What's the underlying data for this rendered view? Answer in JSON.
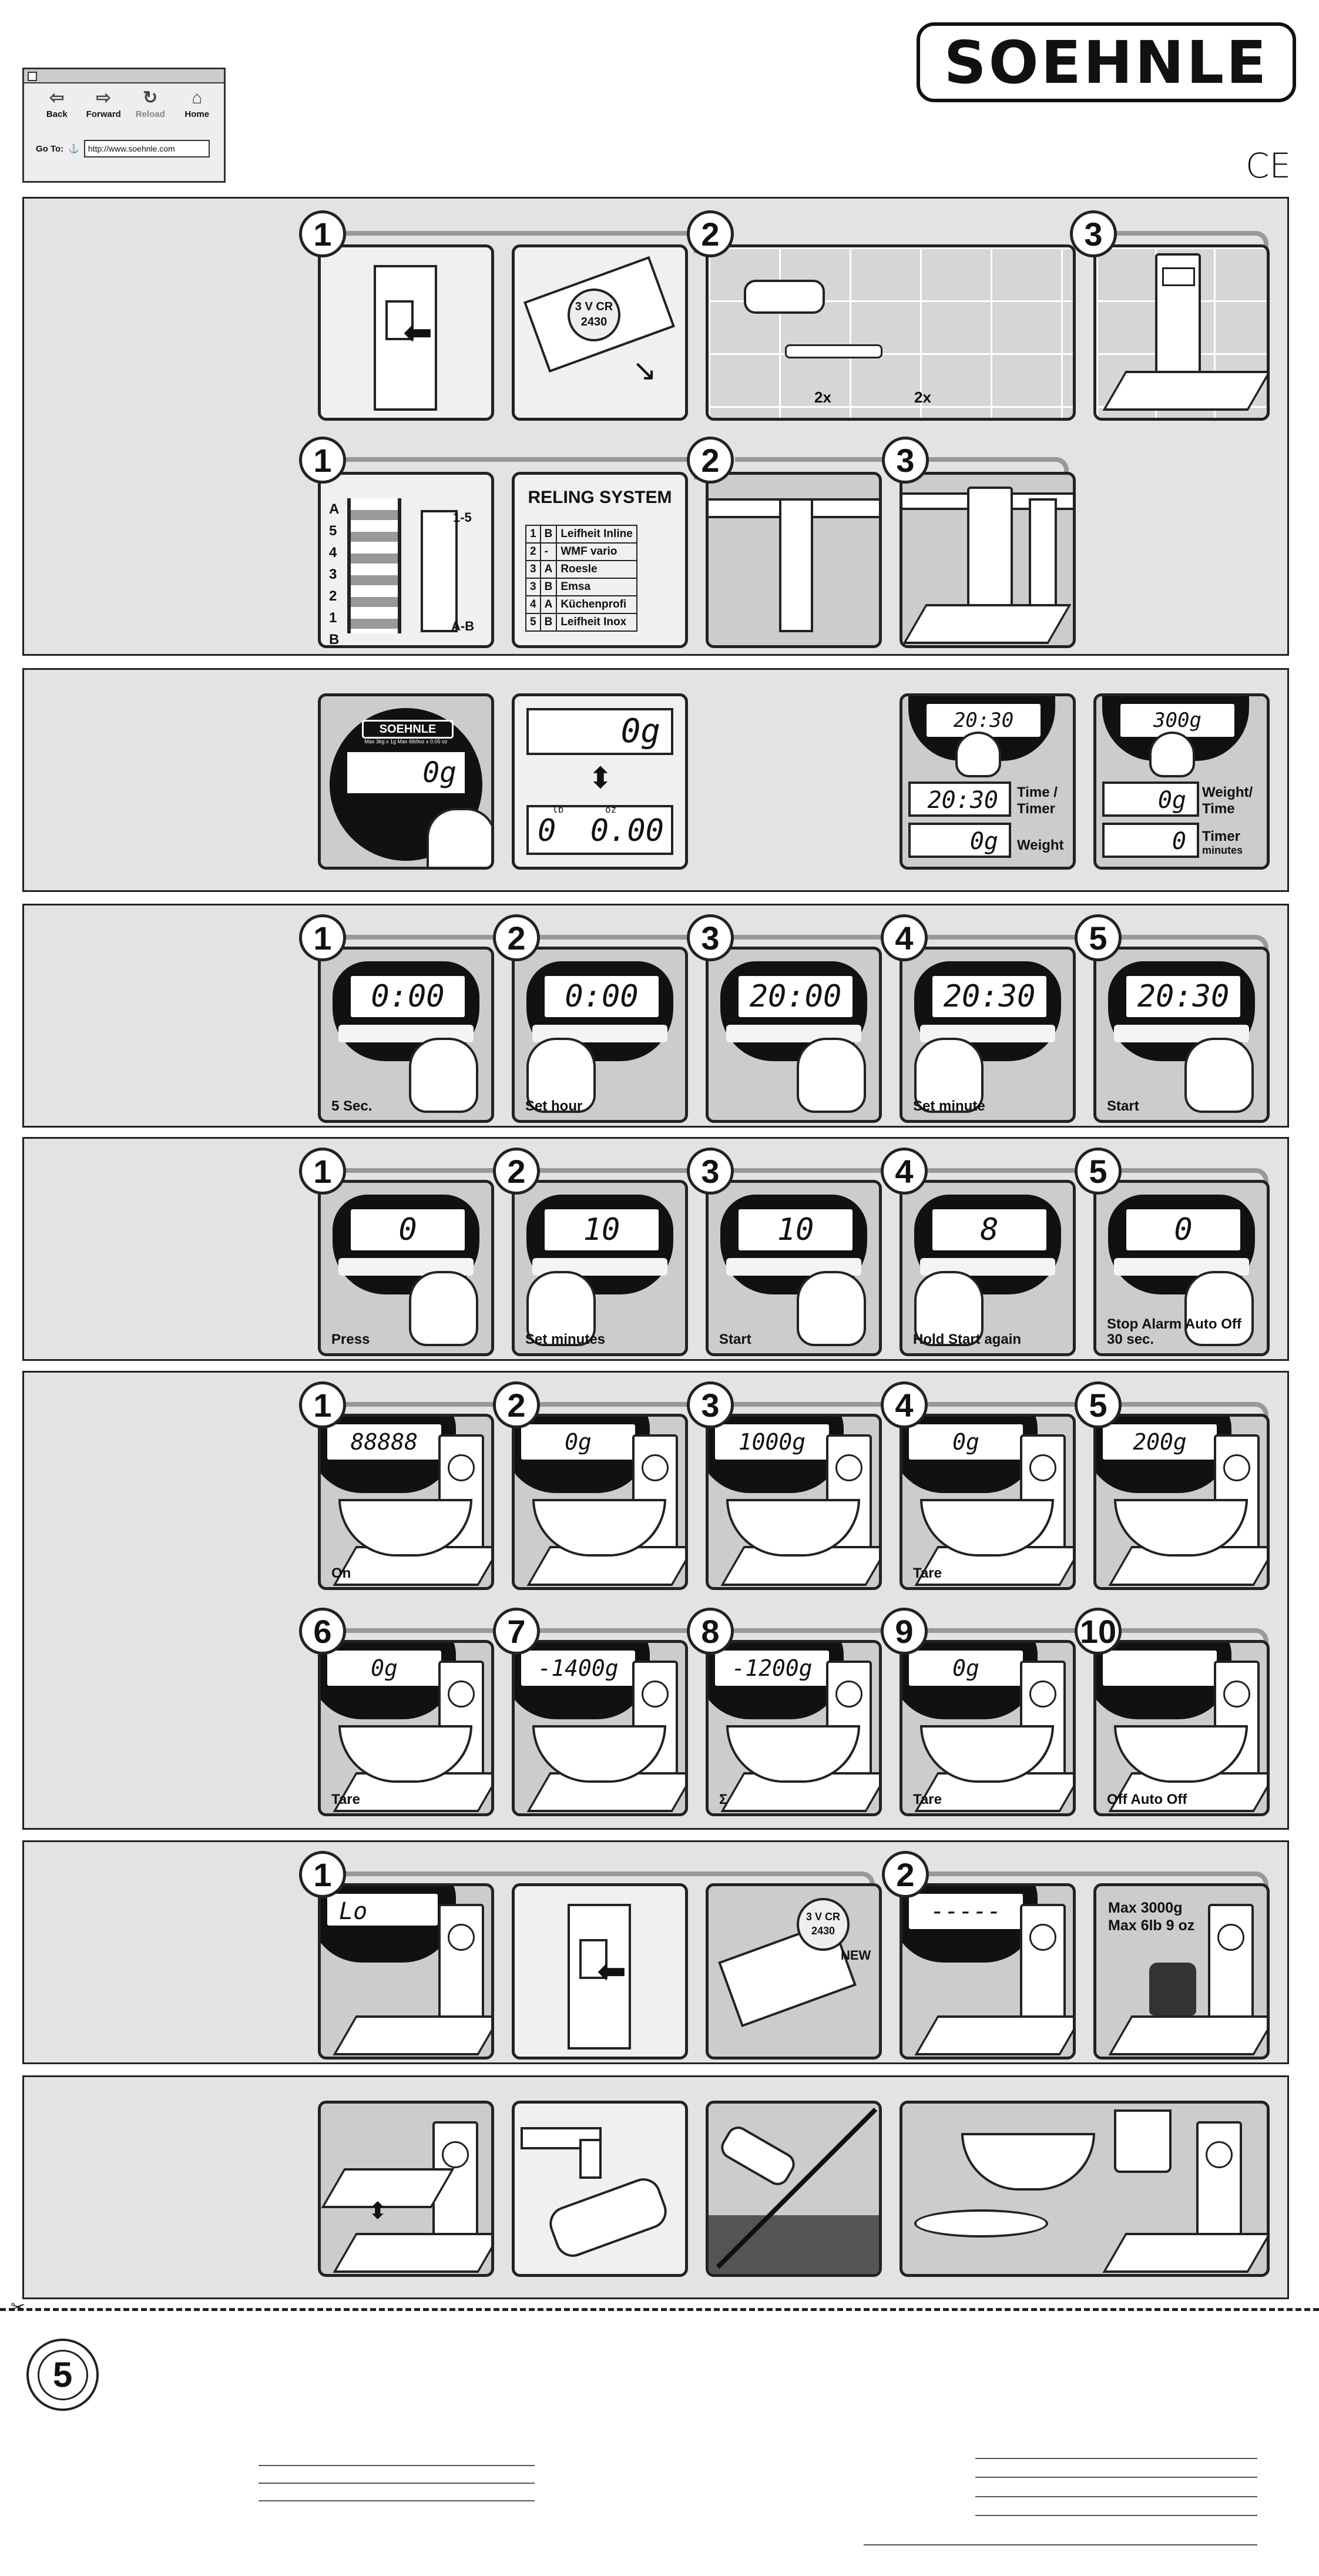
{
  "browser": {
    "buttons": [
      {
        "label": "Back",
        "icon": "back-arrow-icon"
      },
      {
        "label": "Forward",
        "icon": "forward-arrow-icon"
      },
      {
        "label": "Reload",
        "icon": "reload-icon"
      },
      {
        "label": "Home",
        "icon": "home-icon"
      }
    ],
    "goto_label": "Go To:",
    "url": "http://www.soehnle.com"
  },
  "brand": {
    "logo": "SOEHNLE",
    "ce_mark": "CE"
  },
  "mounting": {
    "step_numbers": [
      "1",
      "2",
      "3"
    ],
    "screw_label_1": "2x",
    "screw_label_2": "2x",
    "battery_text": "3 V CR 2430",
    "rail_letters": [
      "A",
      "5",
      "4",
      "3",
      "2",
      "1",
      "B"
    ],
    "rail_range": "1-5",
    "rail_ab": "A-B",
    "reling_title": "RELING SYSTEM",
    "reling_rows": [
      [
        "1",
        "B",
        "Leifheit Inline"
      ],
      [
        "2",
        "-",
        "WMF vario"
      ],
      [
        "3",
        "A",
        "Roesle"
      ],
      [
        "3",
        "B",
        "Emsa"
      ],
      [
        "4",
        "A",
        "Küchenprofi"
      ],
      [
        "5",
        "B",
        "Leifheit Inox"
      ]
    ]
  },
  "units": {
    "scale_brand": "SOEHNLE",
    "scale_spec": "Max 3kg x 1g  Max 6lb9oz x 0.05 oz",
    "display_main": "0g",
    "display_top": "0g",
    "lb_label": "lb",
    "oz_label": "oz",
    "display_lb": "0",
    "display_oz": "0.00",
    "time_display": "20:30",
    "time_label": "Time / Timer",
    "time_lower": "20:30",
    "weight_lower": "0g",
    "weight_label": "Weight",
    "weight_display": "300g",
    "weight_time_label": "Weight/ Time",
    "wt_lower": "0g",
    "timer_lower": "0",
    "timer_label": "Timer",
    "timer_minutes": "minutes"
  },
  "clock": {
    "steps": [
      {
        "n": "1",
        "lcd": "0:00",
        "caption": "5 Sec."
      },
      {
        "n": "2",
        "lcd": "0:00",
        "caption": "Set hour"
      },
      {
        "n": "3",
        "lcd": "20:00",
        "caption": ""
      },
      {
        "n": "4",
        "lcd": "20:30",
        "caption": "Set minute"
      },
      {
        "n": "5",
        "lcd": "20:30",
        "caption": "Start"
      }
    ]
  },
  "timer": {
    "steps": [
      {
        "n": "1",
        "lcd": "0",
        "caption": "Press"
      },
      {
        "n": "2",
        "lcd": "10",
        "caption": "Set minutes"
      },
      {
        "n": "3",
        "lcd": "10",
        "caption": "Start"
      },
      {
        "n": "4",
        "lcd": "8",
        "caption": "Hold Start again"
      },
      {
        "n": "5",
        "lcd": "0",
        "caption": "Stop Alarm Auto Off 30 sec."
      }
    ]
  },
  "weighing": {
    "steps": [
      {
        "n": "1",
        "lcd": "88888",
        "caption": "On"
      },
      {
        "n": "2",
        "lcd": "0g",
        "caption": ""
      },
      {
        "n": "3",
        "lcd": "1000g",
        "caption": ""
      },
      {
        "n": "4",
        "lcd": "0g",
        "caption": "Tare"
      },
      {
        "n": "5",
        "lcd": "200g",
        "caption": ""
      },
      {
        "n": "6",
        "lcd": "0g",
        "caption": "Tare"
      },
      {
        "n": "7",
        "lcd": "-1400g",
        "caption": ""
      },
      {
        "n": "8",
        "lcd": "-1200g",
        "caption": "Σ"
      },
      {
        "n": "9",
        "lcd": "0g",
        "caption": "Tare"
      },
      {
        "n": "10",
        "lcd": "",
        "caption": "Off      Auto Off"
      }
    ]
  },
  "battery": {
    "steps": [
      {
        "n": "1",
        "lcd": "Lo"
      },
      {
        "n": "2",
        "lcd": "-----"
      }
    ],
    "battery_text": "3 V CR 2430",
    "new_label": "NEW",
    "max_text": "Max 3000g Max 6lb 9 oz"
  },
  "warranty": {
    "years": "5"
  }
}
